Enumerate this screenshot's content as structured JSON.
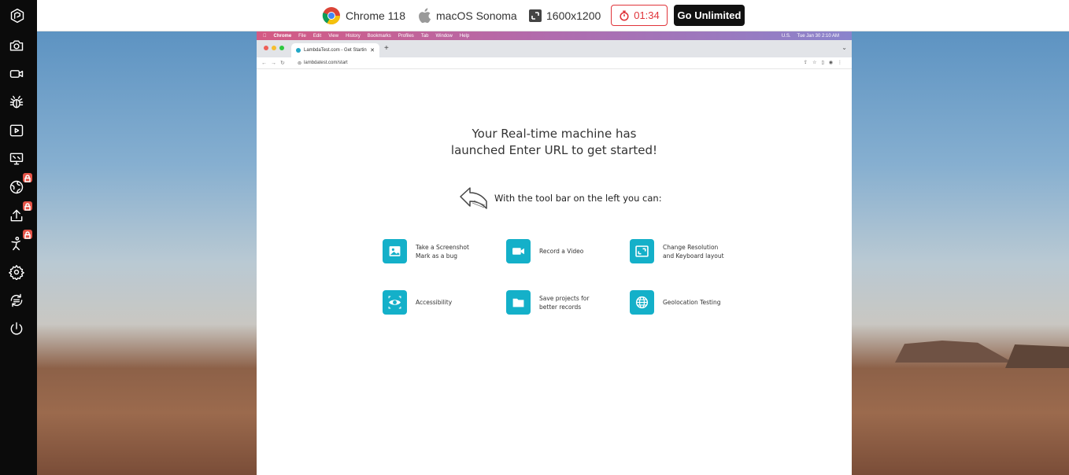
{
  "topbar": {
    "browser": "Chrome 118",
    "os": "macOS Sonoma",
    "resolution": "1600x1200",
    "timer": "01:34",
    "cta": "Go Unlimited"
  },
  "sidebar": {
    "items": [
      {
        "name": "lambdatest-logo-icon"
      },
      {
        "name": "camera-icon"
      },
      {
        "name": "video-icon"
      },
      {
        "name": "bug-icon"
      },
      {
        "name": "play-icon"
      },
      {
        "name": "resolution-icon"
      },
      {
        "name": "geolocation-icon",
        "locked": true
      },
      {
        "name": "upload-icon",
        "locked": true
      },
      {
        "name": "accessibility-icon",
        "locked": true
      },
      {
        "name": "settings-icon"
      },
      {
        "name": "switch-icon"
      },
      {
        "name": "power-icon"
      }
    ]
  },
  "mac": {
    "menubar": [
      "Chrome",
      "File",
      "Edit",
      "View",
      "History",
      "Bookmarks",
      "Profiles",
      "Tab",
      "Window",
      "Help"
    ],
    "menubar_right": [
      "U.S.",
      "Tue Jan 30  2:10 AM"
    ],
    "tab_title": "LambdaTest.com - Get Startin",
    "url": "lambdatest.com/start"
  },
  "page": {
    "headline_line1": "Your Real-time machine has",
    "headline_line2": "launched Enter URL to get started!",
    "hint": "With the tool bar on the left you can:",
    "features": [
      {
        "icon": "screenshot-icon",
        "label": "Take a Screenshot\nMark as a bug"
      },
      {
        "icon": "video-icon",
        "label": "Record a Video"
      },
      {
        "icon": "resolution-icon",
        "label": "Change Resolution\nand Keyboard layout"
      },
      {
        "icon": "eye-icon",
        "label": "Accessibility"
      },
      {
        "icon": "folder-icon",
        "label": "Save projects for\nbetter records"
      },
      {
        "icon": "globe-icon",
        "label": "Geolocation Testing"
      }
    ]
  },
  "colors": {
    "accent": "#14b0c9",
    "timer_red": "#e0343a",
    "sidebar_bg": "#0b0b0b"
  }
}
